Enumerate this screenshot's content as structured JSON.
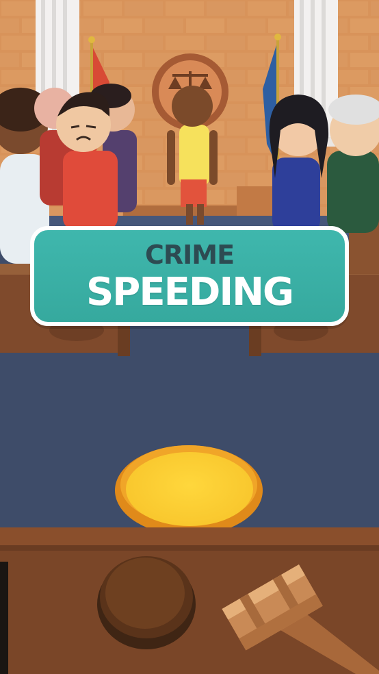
{
  "crime_card": {
    "title": "CRIME",
    "name": "SPEEDING"
  },
  "colors": {
    "card_bg": "#3fb7ad",
    "card_border": "#ffffff",
    "title_text": "#2d4b52",
    "name_text": "#ffffff",
    "wall": "#d9955c",
    "floor": "#3d4b68",
    "button_gold": "#f2b62a",
    "desk": "#7a4a2a"
  },
  "icons": [
    "scales-of-justice-icon",
    "gavel-icon",
    "gavel-sound-block-icon",
    "flag-red-icon",
    "flag-blue-icon"
  ]
}
